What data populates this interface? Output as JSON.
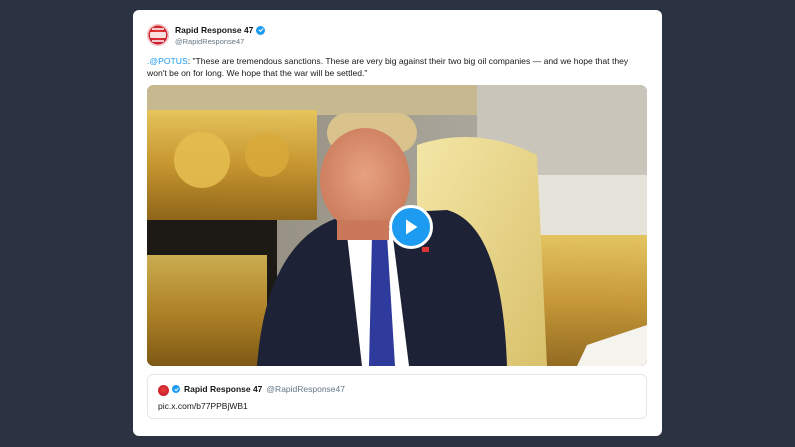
{
  "tweet": {
    "author": {
      "display_name": "Rapid Response 47",
      "handle": "@RapidResponse47",
      "avatar": "rapid-response-logo",
      "verified": true
    },
    "text": {
      "mention": ".@POTUS",
      "body": ": \"These are tremendous sanctions. These are very big against their two big oil companies — and we hope that they won't be on for long. We hope that the war will be settled.\""
    },
    "media": {
      "type": "video",
      "play_icon": "play-icon"
    },
    "quoted": {
      "display_name": "Rapid Response 47",
      "handle": "@RapidResponse47",
      "link": "pic.x.com/b77PPBjWB1",
      "verified": true
    }
  },
  "colors": {
    "page_background": "#2b3241",
    "card_background": "#ffffff",
    "accent": "#1d9bf0",
    "muted_text": "#657786"
  }
}
